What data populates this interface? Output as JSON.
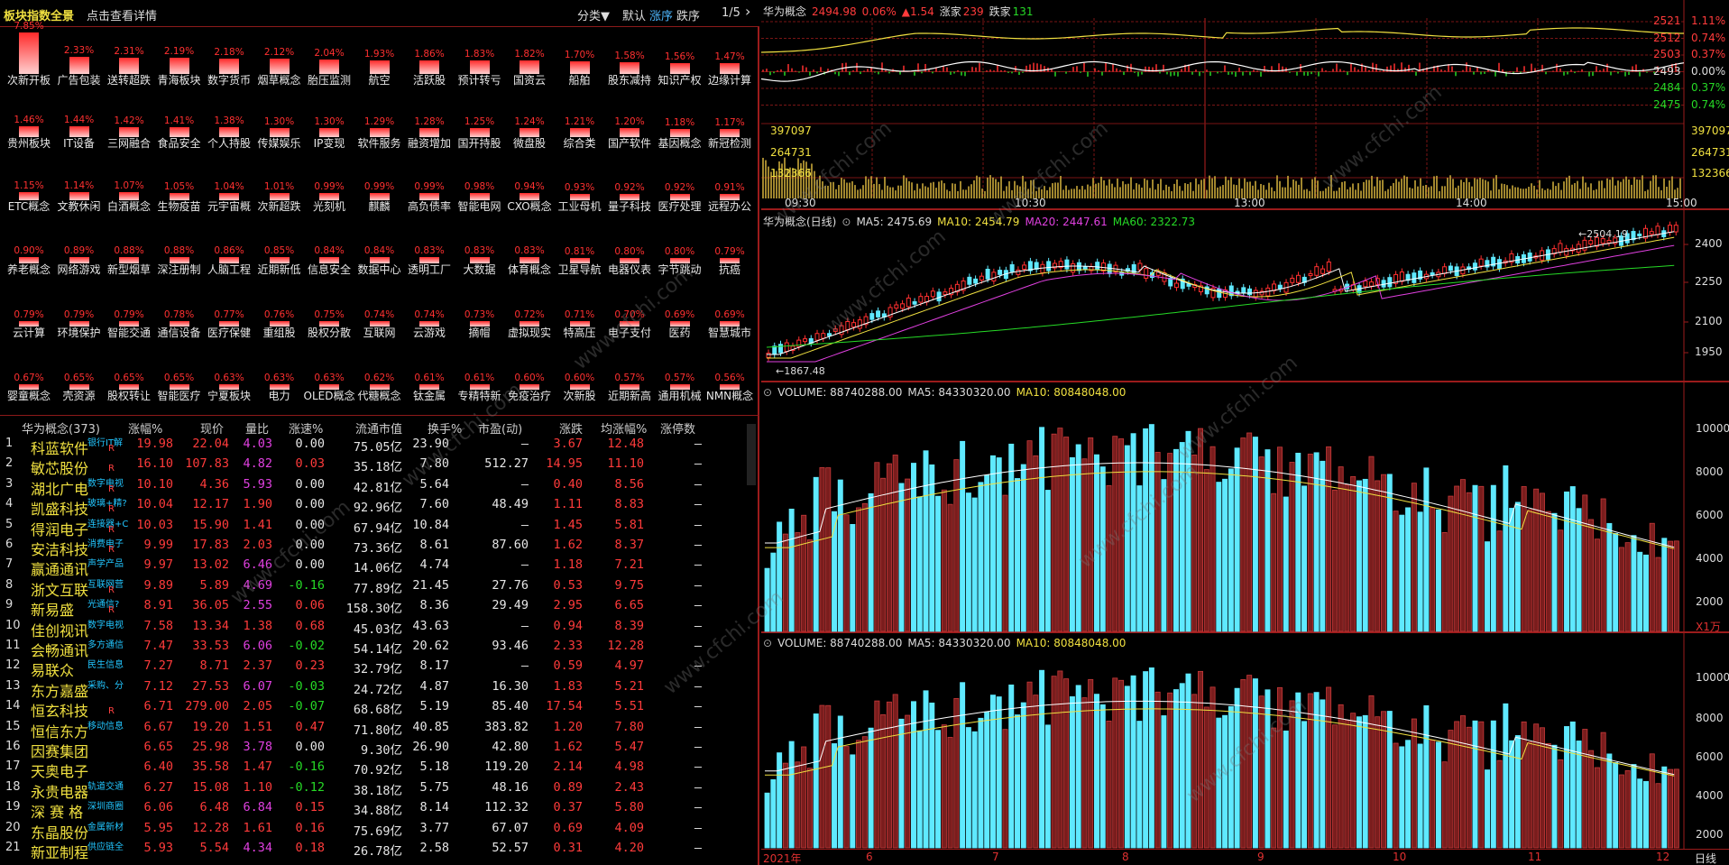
{
  "header": {
    "title": "板块指数全景",
    "detail_link": "点击查看详情",
    "category": "分类▼",
    "default": "默认",
    "asc": "涨序",
    "desc": "跌序",
    "page": "1/5",
    "next": "›"
  },
  "heatmap": [
    {
      "name": "次新开板",
      "pct": "7.85%",
      "v": 7.85
    },
    {
      "name": "广告包装",
      "pct": "2.33%",
      "v": 2.33
    },
    {
      "name": "送转超跌",
      "pct": "2.31%",
      "v": 2.31
    },
    {
      "name": "青海板块",
      "pct": "2.19%",
      "v": 2.19
    },
    {
      "name": "数字货币",
      "pct": "2.18%",
      "v": 2.18
    },
    {
      "name": "烟草概念",
      "pct": "2.12%",
      "v": 2.12
    },
    {
      "name": "胎压监测",
      "pct": "2.04%",
      "v": 2.04
    },
    {
      "name": "航空",
      "pct": "1.93%",
      "v": 1.93
    },
    {
      "name": "活跃股",
      "pct": "1.86%",
      "v": 1.86
    },
    {
      "name": "预计转亏",
      "pct": "1.83%",
      "v": 1.83
    },
    {
      "name": "国资云",
      "pct": "1.82%",
      "v": 1.82
    },
    {
      "name": "船舶",
      "pct": "1.70%",
      "v": 1.7
    },
    {
      "name": "股东减持",
      "pct": "1.58%",
      "v": 1.58
    },
    {
      "name": "知识产权",
      "pct": "1.56%",
      "v": 1.56
    },
    {
      "name": "边缘计算",
      "pct": "1.47%",
      "v": 1.47
    },
    {
      "name": "贵州板块",
      "pct": "1.46%",
      "v": 1.46
    },
    {
      "name": "IT设备",
      "pct": "1.44%",
      "v": 1.44
    },
    {
      "name": "三网融合",
      "pct": "1.42%",
      "v": 1.42
    },
    {
      "name": "食品安全",
      "pct": "1.41%",
      "v": 1.41
    },
    {
      "name": "个人持股",
      "pct": "1.38%",
      "v": 1.38
    },
    {
      "name": "传媒娱乐",
      "pct": "1.30%",
      "v": 1.3
    },
    {
      "name": "IP变现",
      "pct": "1.30%",
      "v": 1.3
    },
    {
      "name": "软件服务",
      "pct": "1.29%",
      "v": 1.29
    },
    {
      "name": "融资增加",
      "pct": "1.28%",
      "v": 1.28
    },
    {
      "name": "国开持股",
      "pct": "1.25%",
      "v": 1.25
    },
    {
      "name": "微盘股",
      "pct": "1.24%",
      "v": 1.24
    },
    {
      "name": "综合类",
      "pct": "1.21%",
      "v": 1.21
    },
    {
      "name": "国产软件",
      "pct": "1.20%",
      "v": 1.2
    },
    {
      "name": "基因概念",
      "pct": "1.18%",
      "v": 1.18
    },
    {
      "name": "新冠检测",
      "pct": "1.17%",
      "v": 1.17
    },
    {
      "name": "ETC概念",
      "pct": "1.15%",
      "v": 1.15
    },
    {
      "name": "文教休闲",
      "pct": "1.14%",
      "v": 1.14
    },
    {
      "name": "白酒概念",
      "pct": "1.07%",
      "v": 1.07
    },
    {
      "name": "生物疫苗",
      "pct": "1.05%",
      "v": 1.05
    },
    {
      "name": "元宇宙概",
      "pct": "1.04%",
      "v": 1.04
    },
    {
      "name": "次新超跌",
      "pct": "1.01%",
      "v": 1.01
    },
    {
      "name": "光刻机",
      "pct": "0.99%",
      "v": 0.99
    },
    {
      "name": "麒麟",
      "pct": "0.99%",
      "v": 0.99
    },
    {
      "name": "高负债率",
      "pct": "0.99%",
      "v": 0.99
    },
    {
      "name": "智能电网",
      "pct": "0.98%",
      "v": 0.98
    },
    {
      "name": "CXO概念",
      "pct": "0.94%",
      "v": 0.94
    },
    {
      "name": "工业母机",
      "pct": "0.93%",
      "v": 0.93
    },
    {
      "name": "量子科技",
      "pct": "0.92%",
      "v": 0.92
    },
    {
      "name": "医疗处理",
      "pct": "0.92%",
      "v": 0.92
    },
    {
      "name": "远程办公",
      "pct": "0.91%",
      "v": 0.91
    },
    {
      "name": "养老概念",
      "pct": "0.90%",
      "v": 0.9
    },
    {
      "name": "网络游戏",
      "pct": "0.89%",
      "v": 0.89
    },
    {
      "name": "新型烟草",
      "pct": "0.88%",
      "v": 0.88
    },
    {
      "name": "深注册制",
      "pct": "0.88%",
      "v": 0.88
    },
    {
      "name": "人脑工程",
      "pct": "0.86%",
      "v": 0.86
    },
    {
      "name": "近期新低",
      "pct": "0.85%",
      "v": 0.85
    },
    {
      "name": "信息安全",
      "pct": "0.84%",
      "v": 0.84
    },
    {
      "name": "数据中心",
      "pct": "0.84%",
      "v": 0.84
    },
    {
      "name": "透明工厂",
      "pct": "0.83%",
      "v": 0.83
    },
    {
      "name": "大数据",
      "pct": "0.83%",
      "v": 0.83
    },
    {
      "name": "体育概念",
      "pct": "0.83%",
      "v": 0.83
    },
    {
      "name": "卫星导航",
      "pct": "0.81%",
      "v": 0.81
    },
    {
      "name": "电器仪表",
      "pct": "0.80%",
      "v": 0.8
    },
    {
      "name": "字节跳动",
      "pct": "0.80%",
      "v": 0.8
    },
    {
      "name": "抗癌",
      "pct": "0.79%",
      "v": 0.79
    },
    {
      "name": "云计算",
      "pct": "0.79%",
      "v": 0.79
    },
    {
      "name": "环境保护",
      "pct": "0.79%",
      "v": 0.79
    },
    {
      "name": "智能交通",
      "pct": "0.79%",
      "v": 0.79
    },
    {
      "name": "通信设备",
      "pct": "0.78%",
      "v": 0.78
    },
    {
      "name": "医疗保健",
      "pct": "0.77%",
      "v": 0.77
    },
    {
      "name": "重组股",
      "pct": "0.76%",
      "v": 0.76
    },
    {
      "name": "股权分散",
      "pct": "0.75%",
      "v": 0.75
    },
    {
      "name": "互联网",
      "pct": "0.74%",
      "v": 0.74
    },
    {
      "name": "云游戏",
      "pct": "0.74%",
      "v": 0.74
    },
    {
      "name": "摘帽",
      "pct": "0.73%",
      "v": 0.73
    },
    {
      "name": "虚拟现实",
      "pct": "0.72%",
      "v": 0.72
    },
    {
      "name": "特高压",
      "pct": "0.71%",
      "v": 0.71
    },
    {
      "name": "电子支付",
      "pct": "0.70%",
      "v": 0.7
    },
    {
      "name": "医药",
      "pct": "0.69%",
      "v": 0.69
    },
    {
      "name": "智慧城市",
      "pct": "0.69%",
      "v": 0.69
    },
    {
      "name": "婴童概念",
      "pct": "0.67%",
      "v": 0.67
    },
    {
      "name": "壳资源",
      "pct": "0.65%",
      "v": 0.65
    },
    {
      "name": "股权转让",
      "pct": "0.65%",
      "v": 0.65
    },
    {
      "name": "智能医疗",
      "pct": "0.65%",
      "v": 0.65
    },
    {
      "name": "宁夏板块",
      "pct": "0.63%",
      "v": 0.63
    },
    {
      "name": "电力",
      "pct": "0.63%",
      "v": 0.63
    },
    {
      "name": "OLED概念",
      "pct": "0.63%",
      "v": 0.63
    },
    {
      "name": "代糖概念",
      "pct": "0.62%",
      "v": 0.62
    },
    {
      "name": "钛金属",
      "pct": "0.61%",
      "v": 0.61
    },
    {
      "name": "专精特新",
      "pct": "0.61%",
      "v": 0.61
    },
    {
      "name": "免疫治疗",
      "pct": "0.60%",
      "v": 0.6
    },
    {
      "name": "次新股",
      "pct": "0.60%",
      "v": 0.6
    },
    {
      "name": "近期新高",
      "pct": "0.57%",
      "v": 0.57
    },
    {
      "name": "通用机械",
      "pct": "0.57%",
      "v": 0.57
    },
    {
      "name": "NMN概念",
      "pct": "0.56%",
      "v": 0.56
    }
  ],
  "table": {
    "headers": {
      "name": "华为概念(373)",
      "chg": "涨幅%",
      "price": "现价",
      "vr": "量比",
      "speed": "涨速%",
      "mcap": "流通市值",
      "turn": "换手%",
      "pe": "市盈(动)",
      "diff": "涨跌",
      "avg": "均涨幅%",
      "limit": "涨停数"
    },
    "rows": [
      {
        "i": "1",
        "name": "科蓝软件",
        "tag": "银行IT解",
        "r": "R",
        "chg": "19.98",
        "price": "22.04",
        "vr": "4.03",
        "speed": "0.00",
        "mcap": "75.05亿",
        "turn": "23.90",
        "pe": "—",
        "diff": "3.67",
        "avg": "12.48",
        "limit": "—"
      },
      {
        "i": "2",
        "name": "敏芯股份",
        "tag": "",
        "r": "R",
        "chg": "16.10",
        "price": "107.83",
        "vr": "4.82",
        "speed": "0.03",
        "mcap": "35.18亿",
        "turn": "7.80",
        "pe": "512.27",
        "diff": "14.95",
        "avg": "11.10",
        "limit": "—"
      },
      {
        "i": "3",
        "name": "湖北广电",
        "tag": "数字电视",
        "r": "R",
        "chg": "10.10",
        "price": "4.36",
        "vr": "5.93",
        "speed": "0.00",
        "mcap": "42.81亿",
        "turn": "5.64",
        "pe": "—",
        "diff": "0.40",
        "avg": "8.56",
        "limit": "—"
      },
      {
        "i": "4",
        "name": "凯盛科技",
        "tag": "玻璃+精?",
        "r": "R",
        "chg": "10.04",
        "price": "12.17",
        "vr": "1.90",
        "speed": "0.00",
        "mcap": "92.96亿",
        "turn": "7.60",
        "pe": "48.49",
        "diff": "1.11",
        "avg": "8.83",
        "limit": "—"
      },
      {
        "i": "5",
        "name": "得润电子",
        "tag": "连接器+C",
        "r": "R",
        "chg": "10.03",
        "price": "15.90",
        "vr": "1.41",
        "speed": "0.00",
        "mcap": "67.94亿",
        "turn": "10.84",
        "pe": "—",
        "diff": "1.45",
        "avg": "5.81",
        "limit": "—"
      },
      {
        "i": "6",
        "name": "安洁科技",
        "tag": "消费电子",
        "r": "R",
        "chg": "9.99",
        "price": "17.83",
        "vr": "2.03",
        "speed": "0.00",
        "mcap": "73.36亿",
        "turn": "8.61",
        "pe": "87.60",
        "diff": "1.62",
        "avg": "8.37",
        "limit": "—"
      },
      {
        "i": "7",
        "name": "赢通通讯",
        "tag": "声学产品",
        "r": "",
        "chg": "9.97",
        "price": "13.02",
        "vr": "6.46",
        "speed": "0.00",
        "mcap": "14.06亿",
        "turn": "4.74",
        "pe": "—",
        "diff": "1.18",
        "avg": "7.21",
        "limit": "—"
      },
      {
        "i": "8",
        "name": "浙文互联",
        "tag": "互联网营",
        "r": "R",
        "chg": "9.89",
        "price": "5.89",
        "vr": "4.69",
        "speed": "-0.16",
        "mcap": "77.89亿",
        "turn": "21.45",
        "pe": "27.76",
        "diff": "0.53",
        "avg": "9.75",
        "limit": "—"
      },
      {
        "i": "9",
        "name": "新易盛",
        "tag": "光通信?",
        "r": "R",
        "chg": "8.91",
        "price": "36.05",
        "vr": "2.55",
        "speed": "0.06",
        "mcap": "158.30亿",
        "turn": "8.36",
        "pe": "29.49",
        "diff": "2.95",
        "avg": "6.65",
        "limit": "—"
      },
      {
        "i": "10",
        "name": "佳创视讯",
        "tag": "数字电视",
        "r": "",
        "chg": "7.58",
        "price": "13.34",
        "vr": "1.38",
        "speed": "0.68",
        "mcap": "45.03亿",
        "turn": "43.63",
        "pe": "—",
        "diff": "0.94",
        "avg": "8.39",
        "limit": "—"
      },
      {
        "i": "11",
        "name": "会畅通讯",
        "tag": "多方通信",
        "r": "",
        "chg": "7.47",
        "price": "33.53",
        "vr": "6.06",
        "speed": "-0.02",
        "mcap": "54.14亿",
        "turn": "20.62",
        "pe": "93.46",
        "diff": "2.33",
        "avg": "12.28",
        "limit": "—"
      },
      {
        "i": "12",
        "name": "易联众",
        "tag": "民生信息",
        "r": "",
        "chg": "7.27",
        "price": "8.71",
        "vr": "2.37",
        "speed": "0.23",
        "mcap": "32.79亿",
        "turn": "8.17",
        "pe": "—",
        "diff": "0.59",
        "avg": "4.97",
        "limit": "—"
      },
      {
        "i": "13",
        "name": "东方嘉盛",
        "tag": "采购、分",
        "r": "",
        "chg": "7.12",
        "price": "27.53",
        "vr": "6.07",
        "speed": "-0.03",
        "mcap": "24.72亿",
        "turn": "4.87",
        "pe": "16.30",
        "diff": "1.83",
        "avg": "5.21",
        "limit": "—"
      },
      {
        "i": "14",
        "name": "恒玄科技",
        "tag": "",
        "r": "R",
        "chg": "6.71",
        "price": "279.00",
        "vr": "2.05",
        "speed": "-0.07",
        "mcap": "68.68亿",
        "turn": "5.19",
        "pe": "85.40",
        "diff": "17.54",
        "avg": "5.51",
        "limit": "—"
      },
      {
        "i": "15",
        "name": "恒信东方",
        "tag": "移动信息",
        "r": "",
        "chg": "6.67",
        "price": "19.20",
        "vr": "1.51",
        "speed": "0.47",
        "mcap": "71.80亿",
        "turn": "40.85",
        "pe": "383.82",
        "diff": "1.20",
        "avg": "7.80",
        "limit": "—"
      },
      {
        "i": "16",
        "name": "因赛集团",
        "tag": "",
        "r": "",
        "chg": "6.65",
        "price": "25.98",
        "vr": "3.78",
        "speed": "0.00",
        "mcap": "9.30亿",
        "turn": "26.90",
        "pe": "42.80",
        "diff": "1.62",
        "avg": "5.47",
        "limit": "—"
      },
      {
        "i": "17",
        "name": "天奥电子",
        "tag": "",
        "r": "",
        "chg": "6.40",
        "price": "35.58",
        "vr": "1.47",
        "speed": "-0.16",
        "mcap": "70.92亿",
        "turn": "5.18",
        "pe": "119.20",
        "diff": "2.14",
        "avg": "4.98",
        "limit": "—"
      },
      {
        "i": "18",
        "name": "永贵电器",
        "tag": "轨道交通",
        "r": "",
        "chg": "6.27",
        "price": "15.08",
        "vr": "1.10",
        "speed": "-0.12",
        "mcap": "38.18亿",
        "turn": "5.75",
        "pe": "48.16",
        "diff": "0.89",
        "avg": "2.43",
        "limit": "—"
      },
      {
        "i": "19",
        "name": "深 赛 格",
        "tag": "深圳商圈",
        "r": "",
        "chg": "6.06",
        "price": "6.48",
        "vr": "6.84",
        "speed": "0.15",
        "mcap": "34.88亿",
        "turn": "8.14",
        "pe": "112.32",
        "diff": "0.37",
        "avg": "5.80",
        "limit": "—"
      },
      {
        "i": "20",
        "name": "东晶股份",
        "tag": "金属新材",
        "r": "",
        "chg": "5.95",
        "price": "12.28",
        "vr": "1.61",
        "speed": "0.16",
        "mcap": "75.69亿",
        "turn": "3.77",
        "pe": "67.07",
        "diff": "0.69",
        "avg": "4.09",
        "limit": "—"
      },
      {
        "i": "21",
        "name": "新亚制程",
        "tag": "供应链全",
        "r": "",
        "chg": "5.93",
        "price": "5.54",
        "vr": "4.34",
        "speed": "0.18",
        "mcap": "26.78亿",
        "turn": "2.58",
        "pe": "52.57",
        "diff": "0.31",
        "avg": "4.20",
        "limit": "—"
      }
    ]
  },
  "intraday": {
    "name": "华为概念",
    "price": "2494.98",
    "chg": "0.06%",
    "delta": "▲1.54",
    "up_label": "涨家",
    "up": "239",
    "down_label": "跌家",
    "down": "131",
    "ylabels": [
      "2521",
      "2512",
      "2503",
      "2493",
      "2484",
      "2475"
    ],
    "rlabels": [
      "1.11%",
      "0.74%",
      "0.37%",
      "0.00%",
      "0.37%",
      "0.74%"
    ],
    "vlabels": [
      "397097",
      "264731",
      "132366"
    ],
    "times": [
      "09:30",
      "10:30",
      "13:00",
      "14:00",
      "15:00"
    ]
  },
  "daily": {
    "title": "华为概念(日线)",
    "ma5": "MA5: 2475.69",
    "ma10": "MA10: 2454.79",
    "ma20": "MA20: 2447.61",
    "ma60": "MA60: 2322.73",
    "high": "2504.19",
    "low": "1867.48",
    "ylabels": [
      "2400",
      "2250",
      "2100",
      "1950"
    ]
  },
  "vol1": {
    "label": "VOLUME: 88740288.00",
    "ma5": "MA5: 84330320.00",
    "ma10": "MA10: 80848048.00",
    "ylabels": [
      "10000",
      "8000",
      "6000",
      "4000",
      "2000"
    ],
    "unit": "X1万"
  },
  "vol2": {
    "label": "VOLUME: 88740288.00",
    "ma5": "MA5: 84330320.00",
    "ma10": "MA10: 80848048.00",
    "ylabels": [
      "10000",
      "8000",
      "6000",
      "4000",
      "2000"
    ]
  },
  "xaxis": {
    "labels": [
      "2021年",
      "6",
      "7",
      "8",
      "9",
      "10",
      "11",
      "12"
    ],
    "period": "日线"
  },
  "watermark": "www.cfchi.com",
  "colors": {
    "up": "#ff3b3b",
    "down": "#26d926",
    "accent": "#f0e040",
    "cyan": "#5fe9ff"
  }
}
